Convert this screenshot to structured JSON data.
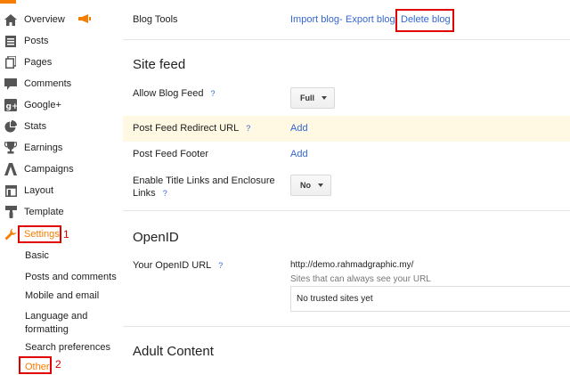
{
  "sidebar": {
    "items": [
      {
        "label": "Overview",
        "icon": "home-icon"
      },
      {
        "label": "Posts",
        "icon": "posts-icon"
      },
      {
        "label": "Pages",
        "icon": "pages-icon"
      },
      {
        "label": "Comments",
        "icon": "comments-icon"
      },
      {
        "label": "Google+",
        "icon": "google-plus-icon"
      },
      {
        "label": "Stats",
        "icon": "stats-icon"
      },
      {
        "label": "Earnings",
        "icon": "trophy-icon"
      },
      {
        "label": "Campaigns",
        "icon": "campaigns-icon"
      },
      {
        "label": "Layout",
        "icon": "layout-icon"
      },
      {
        "label": "Template",
        "icon": "template-icon"
      },
      {
        "label": "Settings",
        "icon": "wrench-icon"
      }
    ],
    "settings_sub": [
      "Basic",
      "Posts and comments",
      "Mobile and email",
      "Language and formatting",
      "Search preferences",
      "Other"
    ],
    "annotation_settings": "1",
    "annotation_other": "2"
  },
  "blog_tools": {
    "label": "Blog Tools",
    "import": "Import blog",
    "separator": "-",
    "export": "Export blog",
    "delete": "Delete blog"
  },
  "site_feed": {
    "title": "Site feed",
    "allow_label": "Allow Blog Feed",
    "allow_value": "Full",
    "redirect_label": "Post Feed Redirect URL",
    "redirect_action": "Add",
    "footer_label": "Post Feed Footer",
    "footer_action": "Add",
    "enclosure_label_1": "Enable Title Links and Enclosure",
    "enclosure_label_2": "Links",
    "enclosure_value": "No",
    "help": "?"
  },
  "openid": {
    "title": "OpenID",
    "url_label": "Your OpenID URL",
    "url_value": "http://demo.rahmadgraphic.my/",
    "hint": "Sites that can always see your URL",
    "trusted": "No trusted sites yet"
  },
  "adult": {
    "title": "Adult Content"
  },
  "colors": {
    "accent": "#f57d00",
    "link": "#3367d6",
    "annotation": "#e00000",
    "highlight": "#fff8e2"
  }
}
